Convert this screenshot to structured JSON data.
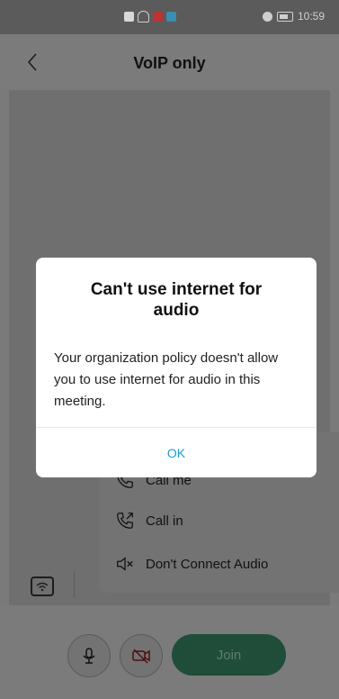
{
  "status_bar": {
    "time": "10:59"
  },
  "header": {
    "title": "VoIP only"
  },
  "audio_options": [
    {
      "label": "Call me",
      "icon": "phone-icon"
    },
    {
      "label": "Call in",
      "icon": "phone-outgoing-icon"
    },
    {
      "label": "Don't Connect Audio",
      "icon": "speaker-muted-icon"
    }
  ],
  "join_button": {
    "label": "Join"
  },
  "dialog": {
    "title": "Can't use internet for audio",
    "message": "Your organization policy doesn't allow you to use internet for audio in this meeting.",
    "ok_label": "OK"
  },
  "colors": {
    "accent": "#1b9bd1",
    "join": "#1f4d3a"
  }
}
